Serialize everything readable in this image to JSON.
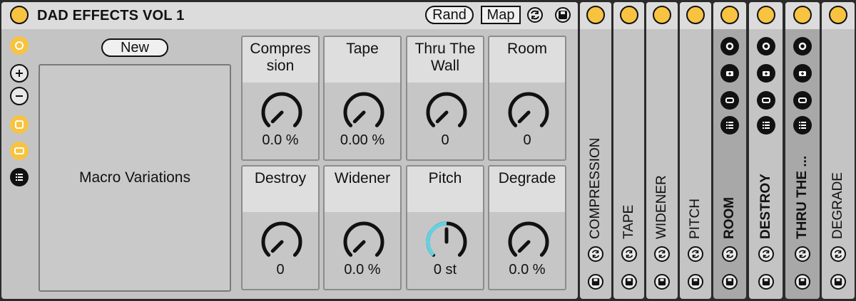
{
  "rack": {
    "title": "DAD EFFECTS VOL 1",
    "rand_label": "Rand",
    "map_label": "Map",
    "new_label": "New",
    "variations_label": "Macro Variations"
  },
  "macros": [
    {
      "label": "Compres sion",
      "value": "0.0 %",
      "level": 0.0
    },
    {
      "label": "Tape",
      "value": "0.00 %",
      "level": 0.0
    },
    {
      "label": "Thru The Wall",
      "value": "0",
      "level": 0.0
    },
    {
      "label": "Room",
      "value": "0",
      "level": 0.0
    },
    {
      "label": "Destroy",
      "value": "0",
      "level": 0.0
    },
    {
      "label": "Widener",
      "value": "0.0 %",
      "level": 0.0
    },
    {
      "label": "Pitch",
      "value": "0 st",
      "level": 0.5
    },
    {
      "label": "Degrade",
      "value": "0.0 %",
      "level": 0.0
    }
  ],
  "chains": [
    {
      "name": "COMPRESSION"
    },
    {
      "name": "TAPE"
    },
    {
      "name": "WIDENER"
    },
    {
      "name": "PITCH"
    },
    {
      "name": "ROOM"
    },
    {
      "name": "DESTROY"
    },
    {
      "name": "THRU THE ..."
    },
    {
      "name": "DEGRADE"
    }
  ],
  "colors": {
    "accent": "#f7c340",
    "active_arc": "#5fd3e6",
    "panel": "#c4c4c4",
    "header": "#dcdcdc"
  }
}
